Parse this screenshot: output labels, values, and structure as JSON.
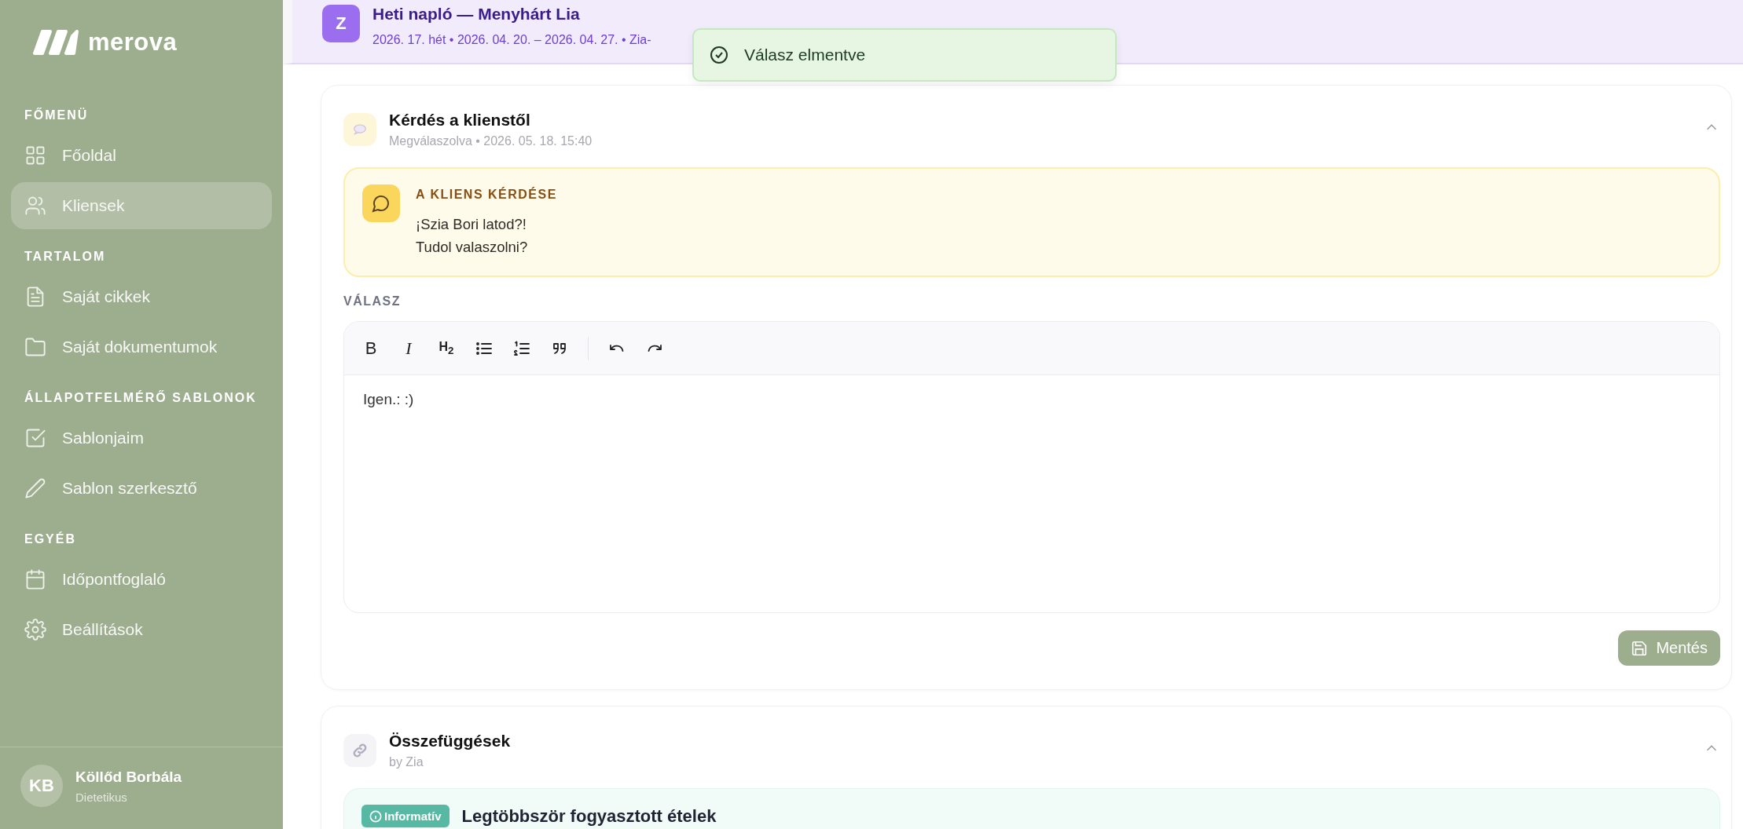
{
  "sidebar": {
    "logo": "merova",
    "sections": [
      {
        "title": "FŐMENÜ",
        "items": [
          {
            "label": "Főoldal",
            "selected": false
          },
          {
            "label": "Kliensek",
            "selected": true
          }
        ]
      },
      {
        "title": "TARTALOM",
        "items": [
          {
            "label": "Saját cikkek",
            "selected": false
          },
          {
            "label": "Saját dokumentumok",
            "selected": false
          }
        ]
      },
      {
        "title": "ÁLLAPOTFELMÉRŐ SABLONOK",
        "items": [
          {
            "label": "Sablonjaim",
            "selected": false
          },
          {
            "label": "Sablon szerkesztő",
            "selected": false
          }
        ]
      },
      {
        "title": "EGYÉB",
        "items": [
          {
            "label": "Időpontfoglaló",
            "selected": false
          },
          {
            "label": "Beállítások",
            "selected": false
          }
        ]
      }
    ],
    "user": {
      "initials": "KB",
      "name": "Köllőd Borbála",
      "role": "Dietetikus"
    }
  },
  "page_header": {
    "avatar": "Z",
    "title": "Heti napló — Menyhárt Lia",
    "subtitle": "2026. 17. hét • 2026. 04. 20. – 2026. 04. 27. • Zia-"
  },
  "toast": {
    "text": "Válasz elmentve"
  },
  "cards": [
    {
      "kind": "question",
      "title": "Kérdés a klienstől",
      "subtitle": "Megválaszolva • 2026. 05. 18. 15:40",
      "expanded": true,
      "question": {
        "label": "A KLIENS KÉRDÉSE",
        "lines": [
          "¡Szia Bori latod?!",
          "Tudol valaszolni?"
        ]
      },
      "answer": {
        "label": "VÁLASZ",
        "value": "Igen.: :)",
        "toolbar": [
          {
            "kind": "bold",
            "label": "B"
          },
          {
            "kind": "italic",
            "label": "I"
          },
          {
            "kind": "heading",
            "label": "H$_{2}$"
          },
          {
            "kind": "bullet-list"
          },
          {
            "kind": "ordered-list"
          },
          {
            "kind": "quote"
          },
          {
            "kind": "separator"
          },
          {
            "kind": "undo"
          },
          {
            "kind": "redo"
          }
        ]
      },
      "save_button": "Mentés"
    },
    {
      "kind": "insights",
      "title": "Összefüggések",
      "subtitle": "by Zia",
      "expanded": true,
      "items": [
        {
          "badge": "Informatív",
          "title": "Legtöbbször fogyasztott ételek"
        }
      ]
    }
  ]
}
